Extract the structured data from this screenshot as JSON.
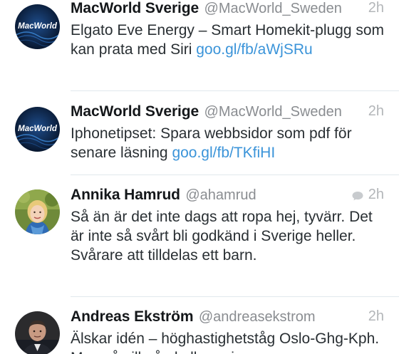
{
  "tweets": [
    {
      "name": "MacWorld Sverige",
      "handle": "@MacWorld_Sweden",
      "time": "2h",
      "text": "Elgato Eve Energy – Smart Homekit-plugg som kan prata med Siri ",
      "link": "goo.gl/fb/aWjSRu",
      "avatar_text": "MacWorld"
    },
    {
      "name": "MacWorld Sverige",
      "handle": "@MacWorld_Sweden",
      "time": "2h",
      "text": "Iphonetipset: Spara webbsidor som pdf för senare läsning ",
      "link": "goo.gl/fb/TKfiHI",
      "avatar_text": "MacWorld"
    },
    {
      "name": "Annika Hamrud",
      "handle": "@ahamrud",
      "time": "2h",
      "text": "Så än är det inte dags att ropa hej, tyvärr. Det är inte så svårt bli godkänd i Sverige heller. Svårare att tilldelas ett barn.",
      "icon": "reply-bubble-icon"
    },
    {
      "name": "Andreas Ekström",
      "handle": "@andreasekstrom",
      "time": "2h",
      "text": "Älskar idén – höghastighetståg Oslo-Ghg-Kph. Men så vill nån kalla regionen"
    }
  ]
}
